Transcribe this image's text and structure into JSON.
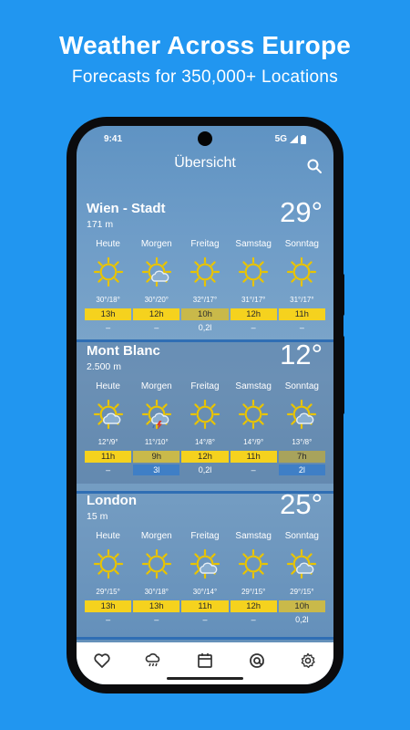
{
  "promo": {
    "title": "Weather Across Europe",
    "subtitle": "Forecasts for 350,000+ Locations"
  },
  "status_bar": {
    "time": "9:41",
    "network": "5G"
  },
  "header": {
    "title": "Übersicht",
    "search_icon": "search-icon"
  },
  "colors": {
    "background": "#2196f0",
    "sun_bar_yellow": "#f5d21e",
    "sun_bar_olive": "#c9b94a",
    "sun_bar_dark": "#a8a35c",
    "precip_blue": "#3f7fc6"
  },
  "locations": [
    {
      "name": "Wien - Stadt",
      "altitude": "171 m",
      "temperature": "29°",
      "days": [
        {
          "name": "Heute",
          "icon": "sun-icon",
          "minmax": "30°/18°",
          "sun_hours": "13h",
          "sun_level": "yellow",
          "precip": "–"
        },
        {
          "name": "Morgen",
          "icon": "sun-cloud-icon",
          "minmax": "30°/20°",
          "sun_hours": "12h",
          "sun_level": "yellow",
          "precip": "–"
        },
        {
          "name": "Freitag",
          "icon": "sun-icon",
          "minmax": "32°/17°",
          "sun_hours": "10h",
          "sun_level": "olive",
          "precip": "0,2l"
        },
        {
          "name": "Samstag",
          "icon": "sun-icon",
          "minmax": "31°/17°",
          "sun_hours": "12h",
          "sun_level": "yellow",
          "precip": "–"
        },
        {
          "name": "Sonntag",
          "icon": "sun-icon",
          "minmax": "31°/17°",
          "sun_hours": "11h",
          "sun_level": "yellow",
          "precip": "–"
        }
      ]
    },
    {
      "name": "Mont Blanc",
      "altitude": "2.500 m",
      "temperature": "12°",
      "days": [
        {
          "name": "Heute",
          "icon": "sun-cloud-icon",
          "minmax": "12°/9°",
          "sun_hours": "11h",
          "sun_level": "yellow",
          "precip": "–"
        },
        {
          "name": "Morgen",
          "icon": "thunderstorm-icon",
          "minmax": "11°/10°",
          "sun_hours": "9h",
          "sun_level": "olive",
          "precip": "3l",
          "precip_filled": true
        },
        {
          "name": "Freitag",
          "icon": "sun-icon",
          "minmax": "14°/8°",
          "sun_hours": "12h",
          "sun_level": "yellow",
          "precip": "0,2l"
        },
        {
          "name": "Samstag",
          "icon": "sun-icon",
          "minmax": "14°/9°",
          "sun_hours": "11h",
          "sun_level": "yellow",
          "precip": "–"
        },
        {
          "name": "Sonntag",
          "icon": "sun-cloud-icon",
          "minmax": "13°/8°",
          "sun_hours": "7h",
          "sun_level": "dark",
          "precip": "2l",
          "precip_filled": true
        }
      ]
    },
    {
      "name": "London",
      "altitude": "15 m",
      "temperature": "25°",
      "days": [
        {
          "name": "Heute",
          "icon": "sun-icon",
          "minmax": "29°/15°",
          "sun_hours": "13h",
          "sun_level": "yellow",
          "precip": "–"
        },
        {
          "name": "Morgen",
          "icon": "sun-icon",
          "minmax": "30°/18°",
          "sun_hours": "13h",
          "sun_level": "yellow",
          "precip": "–"
        },
        {
          "name": "Freitag",
          "icon": "sun-cloud-icon",
          "minmax": "30°/14°",
          "sun_hours": "11h",
          "sun_level": "yellow",
          "precip": "–"
        },
        {
          "name": "Samstag",
          "icon": "sun-icon",
          "minmax": "29°/15°",
          "sun_hours": "12h",
          "sun_level": "yellow",
          "precip": "–"
        },
        {
          "name": "Sonntag",
          "icon": "sun-cloud-icon",
          "minmax": "29°/15°",
          "sun_hours": "10h",
          "sun_level": "olive",
          "precip": "0,2l"
        }
      ]
    }
  ],
  "bottom_nav": [
    {
      "name": "nav-favorites",
      "icon": "heart-icon"
    },
    {
      "name": "nav-radar",
      "icon": "rain-cloud-icon"
    },
    {
      "name": "nav-calendar",
      "icon": "calendar-icon"
    },
    {
      "name": "nav-location",
      "icon": "at-location-icon"
    },
    {
      "name": "nav-settings",
      "icon": "gear-icon"
    }
  ]
}
